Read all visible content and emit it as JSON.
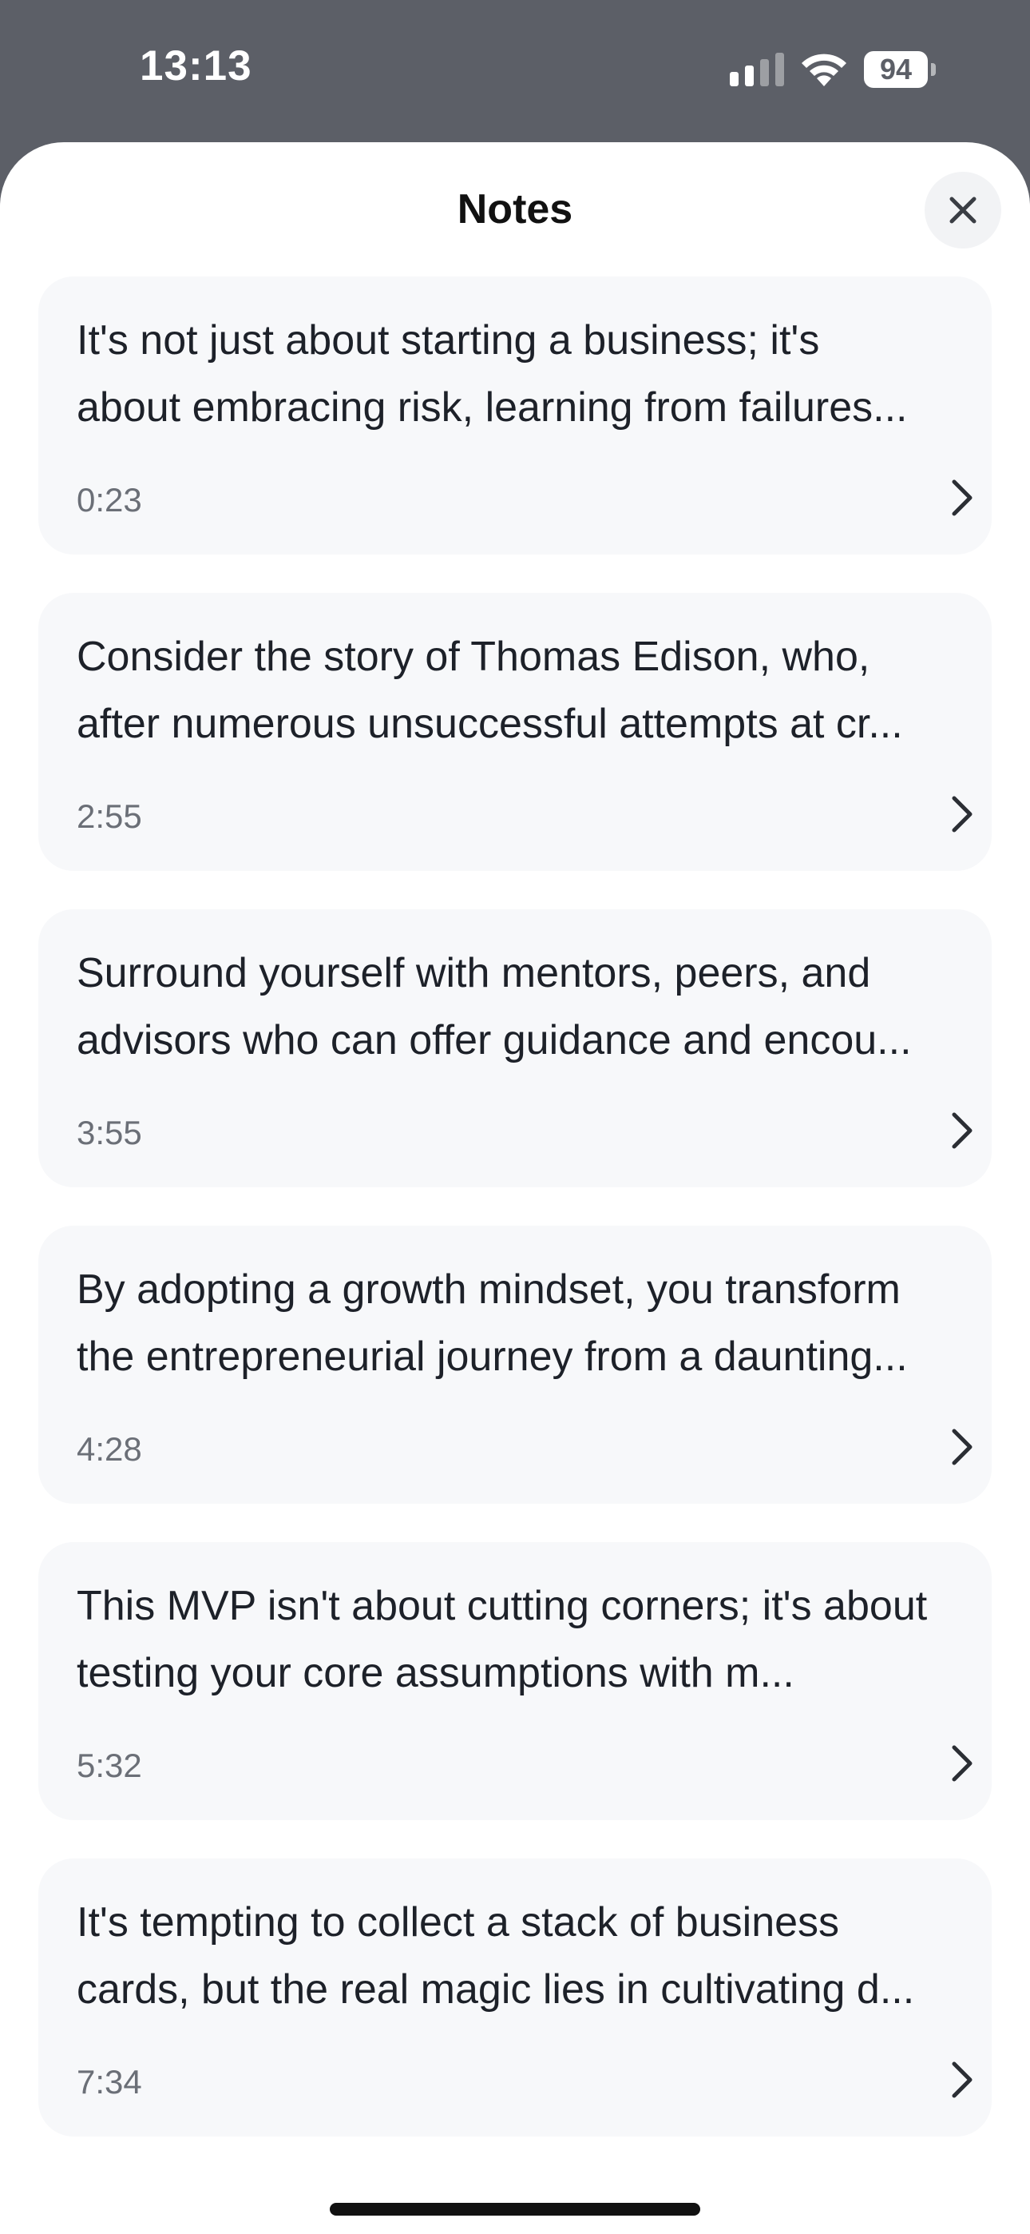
{
  "status_bar": {
    "time": "13:13",
    "battery": "94",
    "icons": [
      "signal-icon",
      "wifi-icon",
      "battery-icon"
    ]
  },
  "sheet": {
    "title": "Notes",
    "close_icon": "close-icon"
  },
  "notes": [
    {
      "text": "It's not just about starting a business; it's about embracing risk, learning from failures...",
      "time": "0:23"
    },
    {
      "text": "Consider the story of Thomas Edison, who, after numerous unsuccessful attempts at cr...",
      "time": "2:55"
    },
    {
      "text": "Surround yourself with mentors, peers, and advisors who can offer guidance and encou...",
      "time": "3:55"
    },
    {
      "text": "By adopting a growth mindset, you transform the entrepreneurial journey from a daunting...",
      "time": "4:28"
    },
    {
      "text": "This MVP isn't about cutting corners; it's about testing your core assumptions with m...",
      "time": "5:32"
    },
    {
      "text": "It's tempting to collect a stack of business cards, but the real magic lies in cultivating d...",
      "time": "7:34"
    }
  ],
  "colors": {
    "status_bg": "#5c5f67",
    "card_bg": "#f7f8fa",
    "text": "#1d2129",
    "muted": "#6b6f77"
  }
}
